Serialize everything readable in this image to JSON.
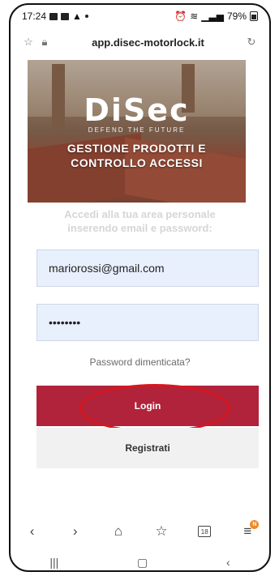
{
  "status_bar": {
    "time": "17:24",
    "battery": "79%"
  },
  "browser": {
    "url": "app.disec-motorlock.it"
  },
  "hero": {
    "brand": "DiSec",
    "tagline": "DEFEND THE FUTURE",
    "title_line1": "GESTIONE PRODOTTI E",
    "title_line2": "CONTROLLO ACCESSI"
  },
  "login": {
    "intro_line1": "Accedi alla tua area personale",
    "intro_line2": "inserendo email e password:",
    "email_value": "mariorossi@gmail.com",
    "password_value": "••••••••",
    "forgot_label": "Password dimenticata?",
    "login_label": "Login",
    "register_label": "Registrati"
  },
  "bottom_nav": {
    "tabs_count": "18",
    "badge": "N"
  },
  "colors": {
    "accent": "#b0233a",
    "annotation": "#d8161e",
    "field_bg": "#e8f0fe"
  }
}
